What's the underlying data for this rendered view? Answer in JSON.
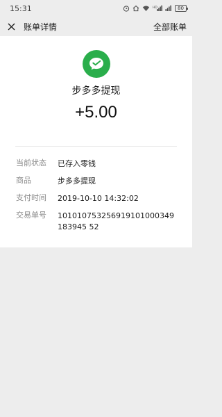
{
  "status_bar": {
    "time": "15:31",
    "battery": "80",
    "icons": [
      "alarm-icon",
      "home-icon",
      "wifi-icon",
      "hd-icon",
      "signal-icon",
      "signal-icon",
      "battery-icon"
    ]
  },
  "nav": {
    "title": "账单详情",
    "right_link": "全部账单",
    "close_icon": "close-icon"
  },
  "transaction": {
    "merchant": "步多多提现",
    "amount": "+5.00",
    "logo_icon": "wechat-pay-icon",
    "logo_color": "#2aae4b"
  },
  "details": [
    {
      "label": "当前状态",
      "value": "已存入零钱"
    },
    {
      "label": "商品",
      "value": "步多多提现"
    },
    {
      "label": "支付时间",
      "value": "2019-10-10 14:32:02"
    },
    {
      "label": "交易单号",
      "value": "101010753256919101000349183945 52"
    }
  ]
}
